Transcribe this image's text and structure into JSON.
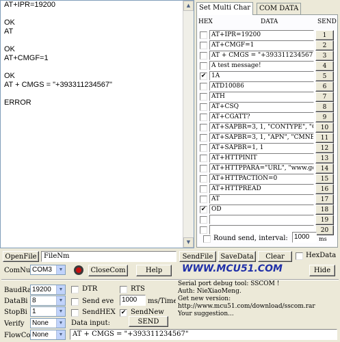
{
  "receive": {
    "lines": [
      "AT+IPR=19200",
      "",
      "OK",
      "AT",
      "",
      "OK",
      "AT+CMGF=1",
      "",
      "OK",
      "AT + CMGS = \"+393311234567\"",
      "",
      "ERROR"
    ]
  },
  "tabs": [
    {
      "label": "Set Multi Char"
    },
    {
      "label": "COM DATA"
    }
  ],
  "multi": {
    "hex_header": "HEX",
    "data_header": "DATA",
    "send_header": "SEND",
    "rows": [
      {
        "checked": "",
        "text": "AT+IPR=19200",
        "btn": "1"
      },
      {
        "checked": "",
        "text": "AT+CMGF=1",
        "btn": "2"
      },
      {
        "checked": "",
        "text": "AT + CMGS = \"+393311234567\"",
        "btn": "3"
      },
      {
        "checked": "",
        "text": "A test message!",
        "btn": "4"
      },
      {
        "checked": "✔",
        "text": "1A",
        "btn": "5"
      },
      {
        "checked": "",
        "text": "ATD10086",
        "btn": "6"
      },
      {
        "checked": "",
        "text": "ATH",
        "btn": "7"
      },
      {
        "checked": "",
        "text": "AT+CSQ",
        "btn": "8"
      },
      {
        "checked": "",
        "text": "AT+CGATT?",
        "btn": "9"
      },
      {
        "checked": "",
        "text": "AT+SAPBR=3, 1,  \"CONTYPE\", \"GPRS\"",
        "btn": "10"
      },
      {
        "checked": "",
        "text": "AT+SAPBR=3, 1,  \"APN\",  \"CMNET\"",
        "btn": "11"
      },
      {
        "checked": "",
        "text": "AT+SAPBR=1, 1",
        "btn": "12"
      },
      {
        "checked": "",
        "text": "AT+HTTPINIT",
        "btn": "13"
      },
      {
        "checked": "",
        "text": "AT+HTTPPARA=\"URL\",  \"www.goo",
        "btn": "14"
      },
      {
        "checked": "",
        "text": "AT+HTTPACTION=0",
        "btn": "15"
      },
      {
        "checked": "",
        "text": "AT+HTTPREAD",
        "btn": "16"
      },
      {
        "checked": "",
        "text": "AT",
        "btn": "17"
      },
      {
        "checked": "✔",
        "text": "OD",
        "btn": "18"
      },
      {
        "checked": "",
        "text": "",
        "btn": "19"
      },
      {
        "checked": "",
        "text": "",
        "btn": "20"
      }
    ],
    "round_send_label": "Round send, interval:",
    "interval_value": "1000",
    "interval_unit": "ms"
  },
  "filebar": {
    "open_file": "OpenFile",
    "file_value": "FileNm",
    "send_file": "SendFile",
    "save_data": "SaveData",
    "clear": "Clear",
    "hex_data": "HexData",
    "comnum_label": "ComNum",
    "com_value": "COM3",
    "close_com": "CloseCom",
    "help": "Help",
    "logo": "WWW.MCU51.COM",
    "hide": "Hide"
  },
  "serial": {
    "baud_label": "BaudRa",
    "baud_value": "19200",
    "databits_label": "DataBi",
    "databits_value": "8",
    "stopbits_label": "StopBi",
    "stopbits_value": "1",
    "verify_label": "Verify",
    "verify_value": "None",
    "flow_label": "FlowCon",
    "flow_value": "None"
  },
  "options": {
    "dtr": "DTR",
    "rts": "RTS",
    "send_every": "Send eve",
    "interval_value": "1000",
    "interval_unit": "ms/Time",
    "send_hex": "SendHEX",
    "send_new": "SendNew",
    "data_input_label": "Data input:",
    "send_button": "SEND",
    "data_input_value": "AT + CMGS = \"+393311234567\""
  },
  "info": {
    "lines": [
      "Serial port debug tool: SSCOM !",
      "Auth: NieXiaoMeng.",
      "Get new version:",
      "http://www.mcu51.com/download/sscom.rar",
      "Your suggestion..."
    ]
  },
  "colors": {
    "window_bg": "#ece9d8",
    "logo": "#1f2fa8",
    "stop_button": "#c81010"
  }
}
